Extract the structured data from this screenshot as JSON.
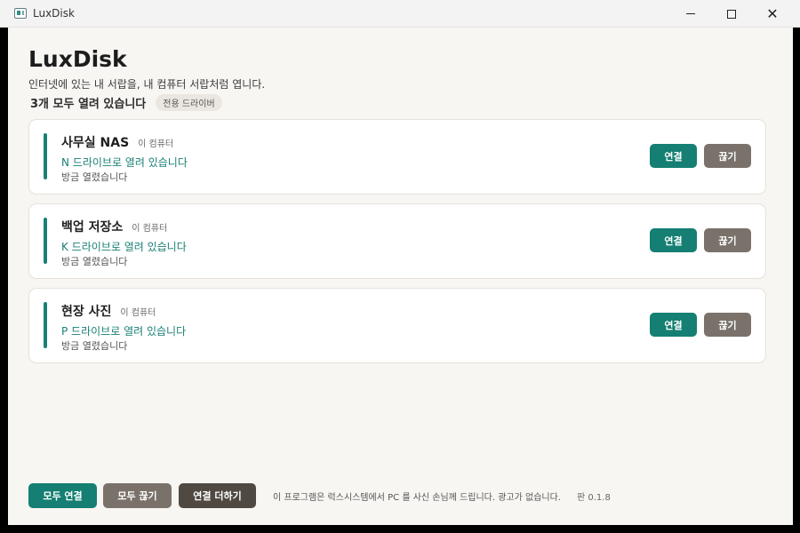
{
  "window": {
    "title": "LuxDisk",
    "close_glyph": "✕"
  },
  "header": {
    "app_title": "LuxDisk",
    "subtitle": "인터넷에 있는 내 서랍을, 내 컴퓨터 서랍처럼 엽니다.",
    "summary": "3개 모두 열려 있습니다",
    "badge": "전용 드라이버"
  },
  "drives": [
    {
      "name": "사무실 NAS",
      "tag": "이 컴퓨터",
      "status": "N 드라이브로 열려 있습니다",
      "time": "방금 열렸습니다",
      "connect_label": "연결",
      "disconnect_label": "끊기"
    },
    {
      "name": "백업 저장소",
      "tag": "이 컴퓨터",
      "status": "K 드라이브로 열려 있습니다",
      "time": "방금 열렸습니다",
      "connect_label": "연결",
      "disconnect_label": "끊기"
    },
    {
      "name": "현장 사진",
      "tag": "이 컴퓨터",
      "status": "P 드라이브로 열려 있습니다",
      "time": "방금 열렸습니다",
      "connect_label": "연결",
      "disconnect_label": "끊기"
    }
  ],
  "footer": {
    "connect_all": "모두 연결",
    "disconnect_all": "모두 끊기",
    "add_connection": "연결 더하기",
    "note": "이 프로그램은 럭스시스템에서 PC 를 사신 손님께 드립니다. 광고가 없습니다.",
    "version": "판 0.1.8"
  },
  "colors": {
    "accent": "#147f72",
    "secondary_button": "#7a726a",
    "dark_button": "#4f4942",
    "background": "#f8f6f3"
  }
}
